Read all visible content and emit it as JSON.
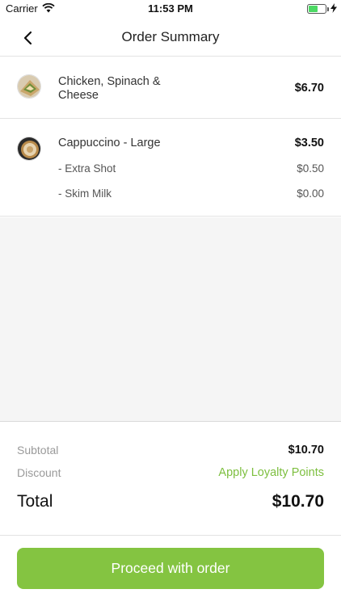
{
  "status_bar": {
    "carrier": "Carrier",
    "time": "11:53 PM",
    "battery_level": 0.55
  },
  "header": {
    "title": "Order Summary"
  },
  "items": [
    {
      "name": "Chicken, Spinach & Cheese",
      "price": "$6.70",
      "thumbnail_icon": "sandwich-thumbnail"
    },
    {
      "name": "Cappuccino - Large",
      "price": "$3.50",
      "thumbnail_icon": "coffee-thumbnail",
      "modifiers": [
        {
          "name": "- Extra Shot",
          "price": "$0.50"
        },
        {
          "name": "- Skim Milk",
          "price": "$0.00"
        }
      ]
    }
  ],
  "summary": {
    "subtotal_label": "Subtotal",
    "subtotal_value": "$10.70",
    "discount_label": "Discount",
    "discount_action": "Apply Loyalty Points",
    "total_label": "Total",
    "total_value": "$10.70"
  },
  "actions": {
    "proceed_label": "Proceed with order"
  },
  "colors": {
    "accent": "#84c441",
    "link": "#7dbf3f"
  }
}
